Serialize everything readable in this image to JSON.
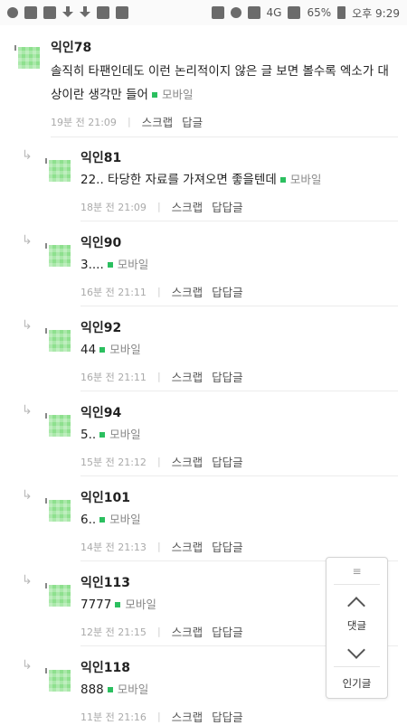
{
  "status_bar": {
    "battery": "65%",
    "clock": "오후 9:29",
    "network": "4G"
  },
  "comments": [
    {
      "name": "익인78",
      "text": "솔직히 타팬인데도 이런 논리적이지 않은 글 보면 볼수록 엑소가 대상이란 생각만 들어",
      "device": "모바일",
      "time": "19분 전 21:09",
      "scrap": "스크랩",
      "reply": "답글",
      "nested": false
    },
    {
      "name": "익인81",
      "text": "22.. 타당한 자료를 가져오면 좋을텐데",
      "device": "모바일",
      "time": "18분 전 21:09",
      "scrap": "스크랩",
      "reply": "답답글",
      "nested": true
    },
    {
      "name": "익인90",
      "text": "3....",
      "device": "모바일",
      "time": "16분 전 21:11",
      "scrap": "스크랩",
      "reply": "답답글",
      "nested": true
    },
    {
      "name": "익인92",
      "text": "44",
      "device": "모바일",
      "time": "16분 전 21:11",
      "scrap": "스크랩",
      "reply": "답답글",
      "nested": true
    },
    {
      "name": "익인94",
      "text": "5..",
      "device": "모바일",
      "time": "15분 전 21:12",
      "scrap": "스크랩",
      "reply": "답답글",
      "nested": true
    },
    {
      "name": "익인101",
      "text": "6..",
      "device": "모바일",
      "time": "14분 전 21:13",
      "scrap": "스크랩",
      "reply": "답답글",
      "nested": true
    },
    {
      "name": "익인113",
      "text": "7777",
      "device": "모바일",
      "time": "12분 전 21:15",
      "scrap": "스크랩",
      "reply": "답답글",
      "nested": true
    },
    {
      "name": "익인118",
      "text": "888",
      "device": "모바일",
      "time": "11분 전 21:16",
      "scrap": "스크랩",
      "reply": "답답글",
      "nested": true
    }
  ],
  "floating_nav": {
    "menu_icon": "hamburger-icon",
    "comments_label": "댓글",
    "popular_label": "인기글"
  }
}
